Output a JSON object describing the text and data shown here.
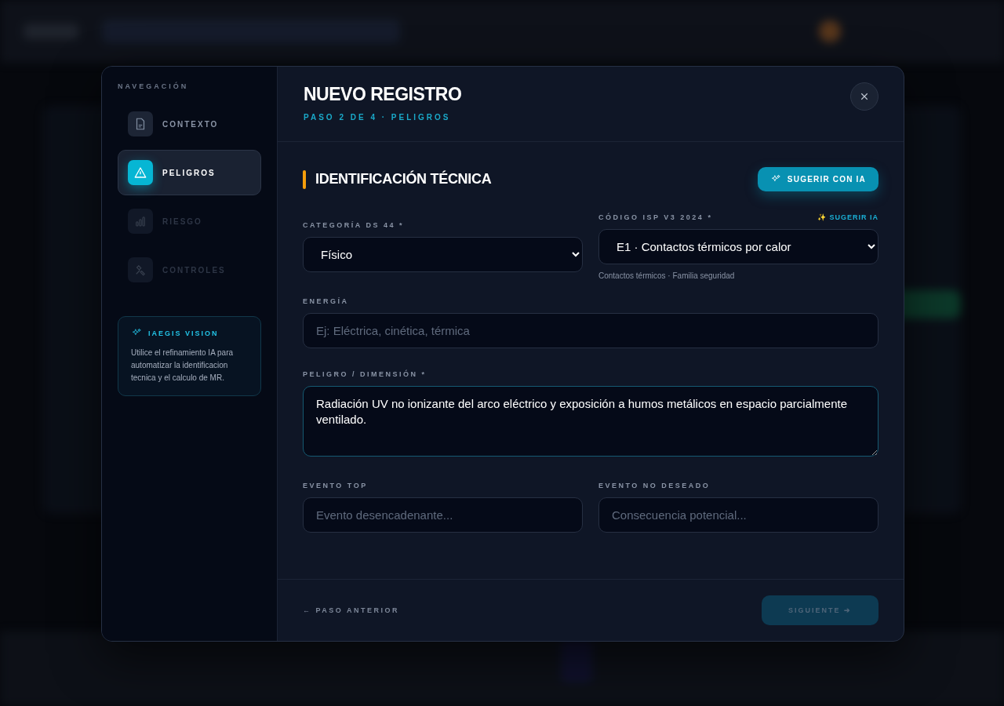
{
  "sidebar": {
    "heading": "NAVEGACIÓN",
    "steps": [
      {
        "label": "CONTEXTO",
        "selected": false,
        "disabled": false
      },
      {
        "label": "PELIGROS",
        "selected": true,
        "disabled": false
      },
      {
        "label": "RIESGO",
        "selected": false,
        "disabled": true
      },
      {
        "label": "CONTROLES",
        "selected": false,
        "disabled": true
      }
    ],
    "info_card": {
      "title": "IAEGIS VISION",
      "text": "Utilice el refinamiento IA para automatizar la identificacion tecnica y el calculo de MR."
    }
  },
  "header": {
    "title": "NUEVO REGISTRO",
    "subtitle": "PASO 2 DE 4 · PELIGROS"
  },
  "section": {
    "title": "IDENTIFICACIÓN TÉCNICA",
    "suggest_button": "SUGERIR CON IA"
  },
  "field_rows": [
    [
      {
        "kind": "select",
        "label": "CATEGORÍA DS 44 *",
        "value": "Físico"
      },
      {
        "kind": "select",
        "label": "CÓDIGO ISP V3 2024 *",
        "value": "E1 · Contactos térmicos por calor",
        "link": "✨ SUGERIR IA",
        "hint": "Contactos térmicos · Familia seguridad"
      }
    ],
    [
      {
        "kind": "input",
        "label": "ENERGÍA",
        "placeholder": "Ej: Eléctrica, cinética, térmica"
      }
    ],
    [
      {
        "kind": "textarea",
        "label": "PELIGRO / DIMENSIÓN *",
        "value": "Radiación UV no ionizante del arco eléctrico y exposición a humos metálicos en espacio parcialmente ventilado."
      }
    ],
    [
      {
        "kind": "input",
        "label": "EVENTO TOP",
        "placeholder": "Evento desencadenante..."
      },
      {
        "kind": "input",
        "label": "EVENTO NO DESEADO",
        "placeholder": "Consecuencia potencial..."
      }
    ]
  ],
  "footer": {
    "back": "← PASO ANTERIOR",
    "next": {
      "label": "SIGUIENTE ➔",
      "disabled": true
    }
  }
}
